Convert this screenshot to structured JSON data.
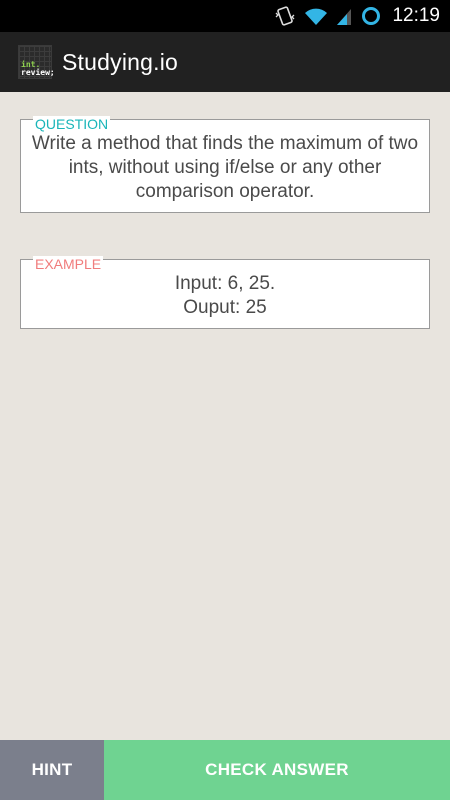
{
  "status_bar": {
    "time": "12:19",
    "icons": [
      "vibrate-icon",
      "wifi-icon",
      "signal-icon",
      "sync-ring-icon"
    ],
    "accent_color": "#33b5e5"
  },
  "action_bar": {
    "logo_line1": "int.",
    "logo_line2": "review;",
    "title": "Studying.io"
  },
  "question": {
    "label": "QUESTION",
    "text": "Write a method that finds the maximum of two ints, without using if/else or any other comparison operator."
  },
  "example": {
    "label": "EXAMPLE",
    "line1": "Input: 6, 25.",
    "line2": "Ouput: 25"
  },
  "buttons": {
    "hint": "HINT",
    "check": "CHECK ANSWER"
  },
  "colors": {
    "question_label": "#19b5b9",
    "example_label": "#f07c7c",
    "hint_button": "#7b7f8c",
    "check_button": "#6fd391",
    "background": "#e8e4de"
  }
}
